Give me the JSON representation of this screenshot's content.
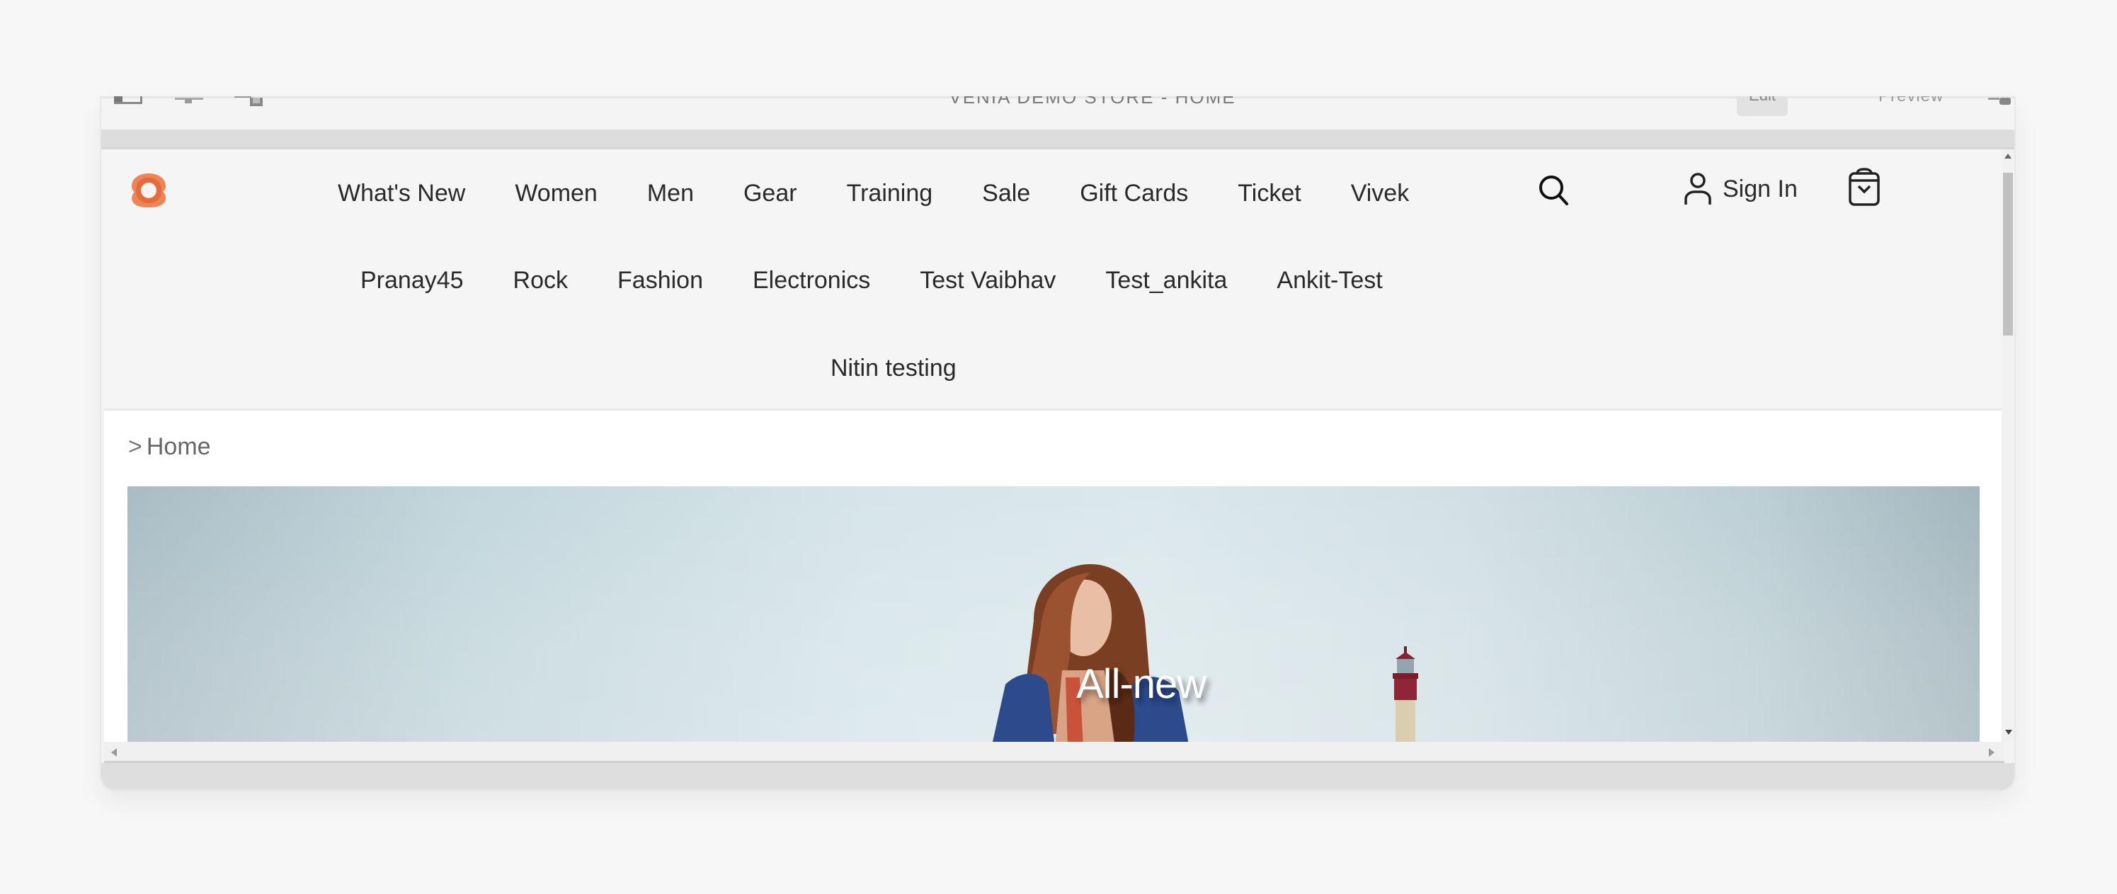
{
  "window": {
    "title": "VENIA DEMO STORE - HOME",
    "toolbar": {
      "left_icons": [
        "sidebar-toggle-icon",
        "desktop-view-icon",
        "mobile-view-icon"
      ],
      "edit_label": "Edit",
      "preview_label": "Preview",
      "right_icon": "share-icon"
    }
  },
  "store": {
    "brand_color": "#e8703a",
    "nav": {
      "row1": [
        "What's New",
        "Women",
        "Men",
        "Gear",
        "Training",
        "Sale",
        "Gift Cards",
        "Ticket",
        "Vivek"
      ],
      "row2": [
        "Pranay45",
        "Rock",
        "Fashion",
        "Electronics",
        "Test Vaibhav",
        "Test_ankita",
        "Ankit-Test"
      ],
      "row3": [
        "Nitin testing"
      ]
    },
    "actions": {
      "search_icon": "search-icon",
      "sign_in_label": "Sign In",
      "account_icon": "user-icon",
      "cart_icon": "shopping-bag-icon"
    },
    "breadcrumb": {
      "separator": ">",
      "current": "Home"
    },
    "banner": {
      "caption": "All-new"
    }
  }
}
